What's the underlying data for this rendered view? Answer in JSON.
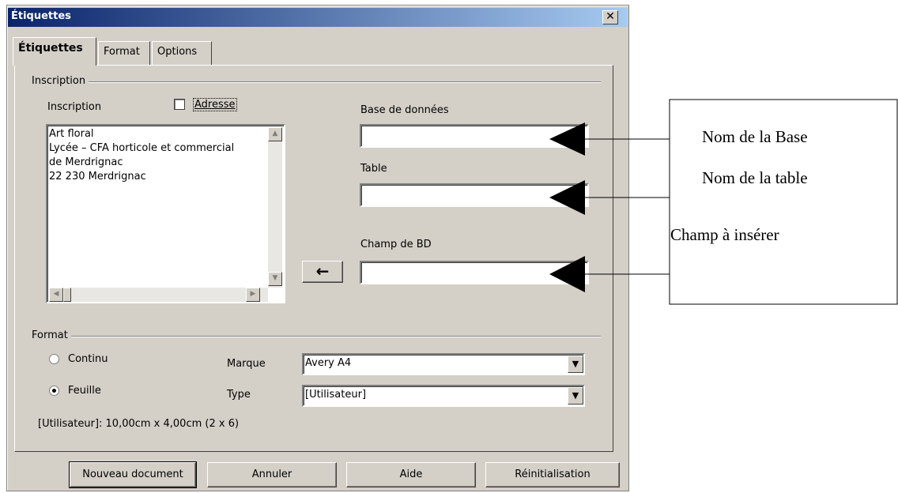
{
  "dialog": {
    "title": "Étiquettes",
    "close_glyph": "✕"
  },
  "tabs": [
    {
      "label": "Étiquettes",
      "active": true
    },
    {
      "label": "Format",
      "active": false
    },
    {
      "label": "Options",
      "active": false
    }
  ],
  "inscription_group": {
    "label": "Inscription",
    "inscription_label": "Inscription",
    "adresse_label": "Adresse",
    "adresse_checked": false,
    "lines": [
      "Art floral",
      "Lycée – CFA horticole et commercial",
      "de Merdrignac",
      "22 230 Merdrignac"
    ],
    "base_label": "Base de données",
    "base_value": "",
    "table_label": "Table",
    "table_value": "",
    "champ_label": "Champ de BD",
    "champ_value": "",
    "insert_arrow": "←"
  },
  "format_group": {
    "label": "Format",
    "continu_label": "Continu",
    "feuille_label": "Feuille",
    "selected": "Feuille",
    "marque_label": "Marque",
    "marque_value": "Avery A4",
    "type_label": "Type",
    "type_value": "[Utilisateur]",
    "info": "[Utilisateur]: 10,00cm x 4,00cm (2 x 6)"
  },
  "buttons": {
    "new_doc": "Nouveau document",
    "cancel": "Annuler",
    "help": "Aide",
    "reset": "Réinitialisation"
  },
  "callouts": {
    "base": "Nom de la Base",
    "table": "Nom de la table",
    "champ": "Champ à insérer"
  },
  "icons": {
    "scroll_up": "up-triangle-icon",
    "scroll_down": "down-triangle-icon",
    "scroll_left": "left-triangle-icon",
    "scroll_right": "right-triangle-icon",
    "dropdown": "down-triangle-icon"
  },
  "colors": {
    "title_bar": "#0a246a",
    "dialog_bg": "#d4d0c8"
  }
}
